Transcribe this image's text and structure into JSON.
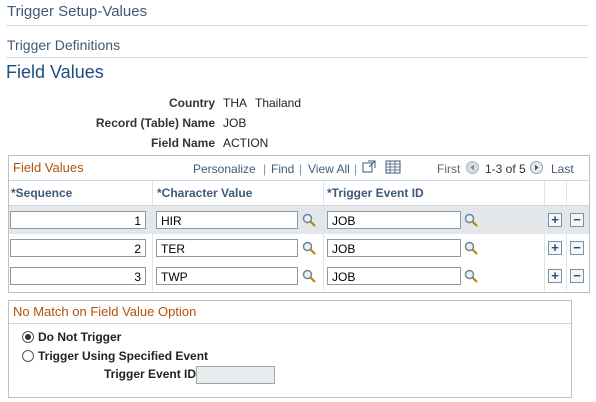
{
  "breadcrumb": {
    "level1": "Trigger Setup-Values",
    "level2": "Trigger Definitions"
  },
  "page_title": "Field Values",
  "info": {
    "country_label": "Country",
    "country_code": "THA",
    "country_name": "Thailand",
    "record_label": "Record (Table) Name",
    "record_value": "JOB",
    "field_label": "Field Name",
    "field_value": "ACTION"
  },
  "grid": {
    "title": "Field Values",
    "nav": {
      "personalize": "Personalize",
      "sep1": "|",
      "find": "Find",
      "sep2": "|",
      "view_all": "View All",
      "sep3": "|",
      "first": "First",
      "range": "1-3 of 5",
      "last": "Last"
    },
    "columns": {
      "sequence": "*Sequence",
      "char_value": "*Character Value",
      "event_id": "*Trigger Event ID"
    },
    "rows": [
      {
        "sequence": "1",
        "char_value": "HIR",
        "event_id": "JOB"
      },
      {
        "sequence": "2",
        "char_value": "TER",
        "event_id": "JOB"
      },
      {
        "sequence": "3",
        "char_value": "TWP",
        "event_id": "JOB"
      }
    ],
    "add_symbol": "+",
    "remove_symbol": "−"
  },
  "no_match": {
    "title": "No Match on Field Value Option",
    "option1": "Do Not Trigger",
    "option2": "Trigger Using Specified Event",
    "event_label": "Trigger Event ID",
    "event_value": ""
  },
  "colors": {
    "accent": "#b3520b",
    "link": "#3e5a7a",
    "title": "#1e4e7e"
  }
}
